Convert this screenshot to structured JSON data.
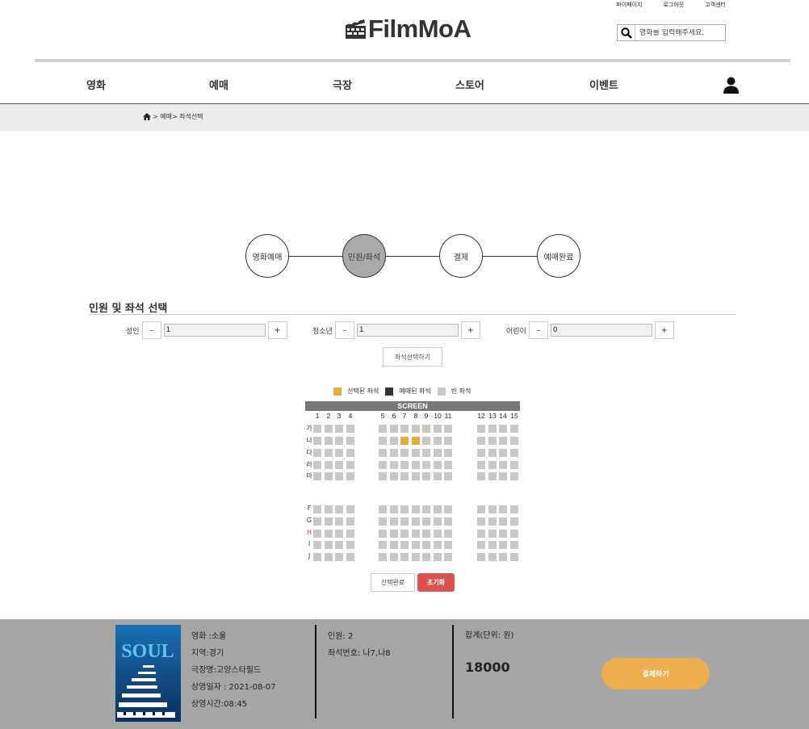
{
  "header": {
    "top_links": [
      "마이페이지",
      "로그아웃",
      "고객센터"
    ],
    "logo_text": "FilmMoA",
    "search_placeholder": "영화를 입력해주세요."
  },
  "nav": {
    "items": [
      "영화",
      "예매",
      "극장",
      "스토어",
      "이벤트"
    ]
  },
  "breadcrumb": {
    "text": "> 예매> 좌석선택"
  },
  "steps": [
    "영화예매",
    "인원/좌석",
    "결제",
    "예매완료"
  ],
  "active_step": 1,
  "section": {
    "title": "인원 및 좌석 선택"
  },
  "counters": [
    {
      "label": "성인",
      "value": "1"
    },
    {
      "label": "청소년",
      "value": "1"
    },
    {
      "label": "어린이",
      "value": "0"
    }
  ],
  "counter_buttons": {
    "minus": "–",
    "plus": "+"
  },
  "seat_select_button": "좌석선택하기",
  "legend": [
    {
      "label": "선택된 좌석",
      "color": "#e8a840"
    },
    {
      "label": "예매된 좌석",
      "color": "#333333"
    },
    {
      "label": "빈 좌석",
      "color": "#c8c8c8"
    }
  ],
  "seat_map": {
    "screen_label": "SCREEN",
    "columns": [
      "1",
      "2",
      "3",
      "4",
      "5",
      "6",
      "7",
      "8",
      "9",
      "10",
      "11",
      "12",
      "13",
      "14",
      "15"
    ],
    "rows": [
      "가",
      "나",
      "다",
      "라",
      "마",
      "F",
      "G",
      "H",
      "I",
      "J"
    ],
    "selected_seats": [
      "나7",
      "나8"
    ]
  },
  "actions": {
    "complete": "선택완료",
    "reset": "초기화"
  },
  "footer": {
    "movie_info": [
      "영화 :소울",
      "지역:경기",
      "극장명:고양스타필드",
      "상영일자 : 2021-08-07",
      "상영시간:08:45"
    ],
    "people": "인원: 2",
    "seat_numbers": "좌석번호: 나7,나8",
    "total_label": "합계(단위: 원)",
    "total": "18000",
    "pay_button": "결제하기",
    "poster_title": "SOUL"
  }
}
